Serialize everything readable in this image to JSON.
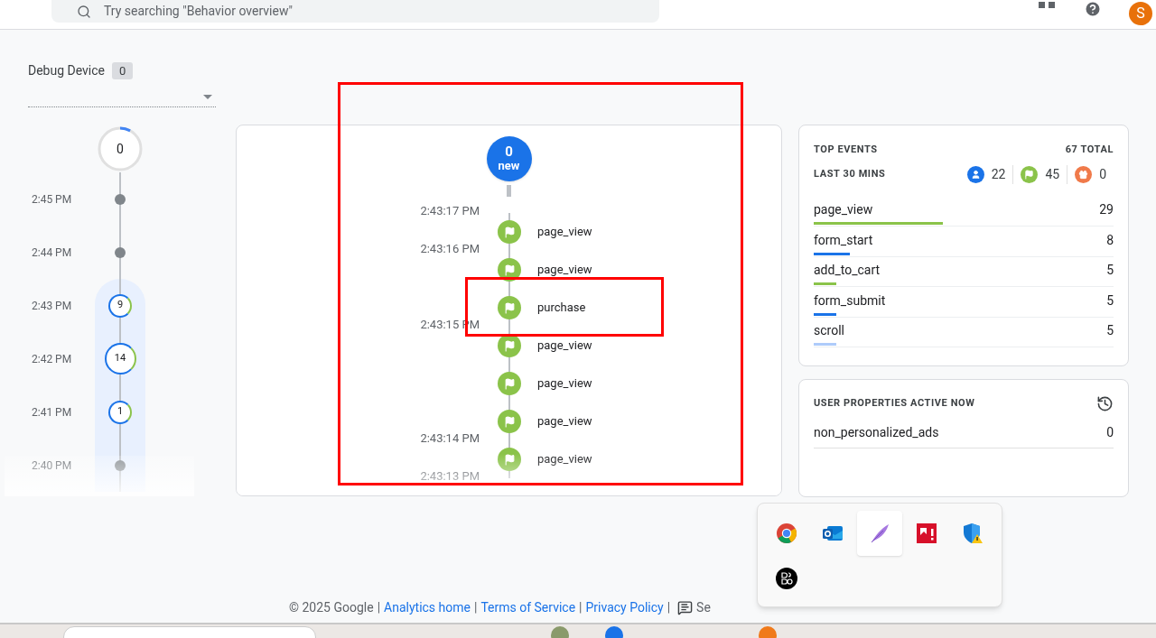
{
  "header": {
    "search": {
      "placeholder": "Try searching \"Behavior overview\""
    },
    "avatar": "S"
  },
  "debug_device": {
    "label": "Debug Device",
    "count": "0"
  },
  "minutes_timeline": {
    "top": {
      "count": "0",
      "level": 0.08
    },
    "rows": [
      {
        "time": "2:45 PM",
        "kind": "dot",
        "highlighted": false
      },
      {
        "time": "2:44 PM",
        "kind": "dot",
        "highlighted": false
      },
      {
        "time": "2:43 PM",
        "kind": "count",
        "count": "9",
        "highlighted": true
      },
      {
        "time": "2:42 PM",
        "kind": "count",
        "count": "14",
        "highlighted": true
      },
      {
        "time": "2:41 PM",
        "kind": "count",
        "count": "1",
        "highlighted": true
      },
      {
        "time": "2:40 PM",
        "kind": "dot",
        "highlighted": true
      }
    ]
  },
  "seconds_stream": {
    "new_count": "0",
    "new_label": "new",
    "events": [
      {
        "time": "2:43:17 PM",
        "name": "page_view"
      },
      {
        "time": "2:43:16 PM",
        "name": "page_view"
      },
      {
        "name": "purchase"
      },
      {
        "time": "2:43:15 PM",
        "name": "page_view"
      },
      {
        "name": "page_view"
      },
      {
        "name": "page_view"
      },
      {
        "time": "2:43:14 PM",
        "name": "page_view"
      }
    ],
    "trailing_time": "2:43:13 PM"
  },
  "top_events": {
    "title": "TOP EVENTS",
    "total": "67 TOTAL",
    "period": "LAST 30 MINS",
    "counts": [
      {
        "kind": "user",
        "value": "22",
        "color": "#1a73e8"
      },
      {
        "kind": "flag",
        "value": "45",
        "color": "#8bc34a"
      },
      {
        "kind": "gift",
        "value": "0",
        "color": "#f07a4a"
      }
    ],
    "rows": [
      {
        "name": "page_view",
        "count": "29",
        "level": 0.43,
        "color": "#8bc34a"
      },
      {
        "name": "form_start",
        "count": "8",
        "level": 0.12,
        "color": "#1a73e8"
      },
      {
        "name": "add_to_cart",
        "count": "5",
        "level": 0.075,
        "color": "#8bc34a"
      },
      {
        "name": "form_submit",
        "count": "5",
        "level": 0.075,
        "color": "#1a73e8"
      },
      {
        "name": "scroll",
        "count": "5",
        "level": 0.075,
        "color": "#aecbfa"
      }
    ]
  },
  "user_properties": {
    "title": "USER PROPERTIES ACTIVE NOW",
    "rows": [
      {
        "name": "non_personalized_ads",
        "value": "0"
      }
    ]
  },
  "footer": {
    "copyright": "© 2025 Google",
    "separator": "|",
    "links": [
      "Analytics home",
      "Terms of Service",
      "Privacy Policy"
    ],
    "feedback": "Se"
  },
  "tray_popup": {
    "icons": [
      {
        "kind": "browser",
        "selected": false
      },
      {
        "kind": "mail",
        "selected": false
      },
      {
        "kind": "feather",
        "selected": true
      },
      {
        "kind": "red-square",
        "selected": false
      },
      {
        "kind": "shield",
        "selected": false
      },
      {
        "kind": "round-logo",
        "selected": false
      }
    ]
  }
}
